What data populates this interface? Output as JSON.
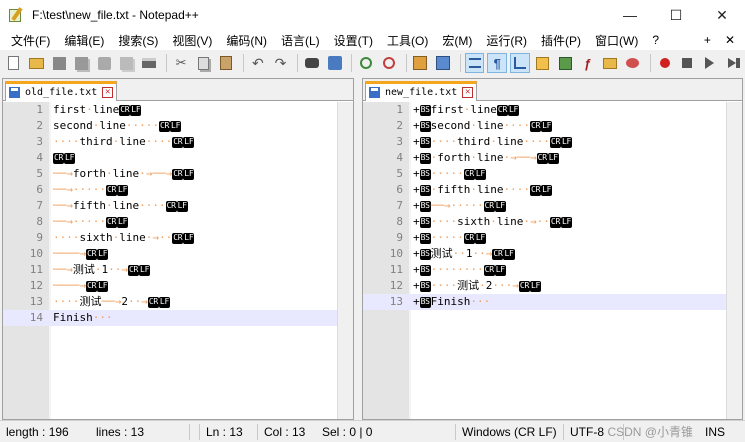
{
  "window": {
    "title": "F:\\test\\new_file.txt - Notepad++",
    "minimize": "—",
    "maximize": "☐",
    "close": "✕"
  },
  "menu": [
    "文件(F)",
    "编辑(E)",
    "搜索(S)",
    "视图(V)",
    "编码(N)",
    "语言(L)",
    "设置(T)",
    "工具(O)",
    "宏(M)",
    "运行(R)",
    "插件(P)",
    "窗口(W)",
    "?"
  ],
  "menu_plus": "+",
  "menu_close": "✕",
  "left": {
    "tab_label": "old_file.txt",
    "lines": [
      {
        "n": "1",
        "t": "first·line",
        "eol": "CRLF"
      },
      {
        "n": "2",
        "t": "second·line·····",
        "eol": "CRLF"
      },
      {
        "n": "3",
        "t": "····third·line····",
        "eol": "CRLF"
      },
      {
        "n": "4",
        "t": "",
        "eol": "CRLF"
      },
      {
        "n": "5",
        "t": "──→forth·line·→──→",
        "eol": "CRLF"
      },
      {
        "n": "6",
        "t": "──→·····",
        "eol": "CRLF"
      },
      {
        "n": "7",
        "t": "──→fifth·line····",
        "eol": "CRLF"
      },
      {
        "n": "8",
        "t": "──→·····",
        "eol": "CRLF"
      },
      {
        "n": "9",
        "t": "····sixth·line·→··",
        "eol": "CRLF"
      },
      {
        "n": "10",
        "t": "────→",
        "eol": "CRLF"
      },
      {
        "n": "11",
        "t": "──→测试·1··→",
        "eol": "CRLF"
      },
      {
        "n": "12",
        "t": "────→",
        "eol": "CRLF"
      },
      {
        "n": "13",
        "t": "····测试──→2··→",
        "eol": "CRLF"
      },
      {
        "n": "14",
        "t": "Finish···",
        "eol": ""
      }
    ]
  },
  "right": {
    "tab_label": "new_file.txt",
    "lines": [
      {
        "n": "1",
        "p": "+BS",
        "t": "first·line",
        "eol": "CRLF"
      },
      {
        "n": "2",
        "p": "+BS",
        "t": "second·line····",
        "eol": "CRLF"
      },
      {
        "n": "3",
        "p": "+BS",
        "t": "····third·line····",
        "eol": "CRLF"
      },
      {
        "n": "4",
        "p": "+BS",
        "t": "·forth·line·→──→",
        "eol": "CRLF"
      },
      {
        "n": "5",
        "p": "+BS",
        "t": "·····",
        "eol": "CRLF"
      },
      {
        "n": "6",
        "p": "+BS",
        "t": "·fifth·line····",
        "eol": "CRLF"
      },
      {
        "n": "7",
        "p": "+BS",
        "t": "──→·····",
        "eol": "CRLF"
      },
      {
        "n": "8",
        "p": "+BS",
        "t": "····sixth·line·→··",
        "eol": "CRLF"
      },
      {
        "n": "9",
        "p": "+BS",
        "t": "·····",
        "eol": "CRLF"
      },
      {
        "n": "10",
        "p": "+BS",
        "t": "测试··1··→",
        "eol": "CRLF"
      },
      {
        "n": "11",
        "p": "+BS",
        "t": "········",
        "eol": "CRLF"
      },
      {
        "n": "12",
        "p": "+BS",
        "t": "····测试·2···→",
        "eol": "CRLF"
      },
      {
        "n": "13",
        "p": "+BS",
        "t": "Finish···",
        "eol": ""
      }
    ]
  },
  "status": {
    "length": "length : 196",
    "lines": "lines : 13",
    "ln": "Ln : 13",
    "col": "Col : 13",
    "sel": "Sel : 0 | 0",
    "eol": "Windows (CR LF)",
    "encoding": "UTF-8",
    "ins": "INS"
  },
  "watermark": "CSDN @小青锥"
}
